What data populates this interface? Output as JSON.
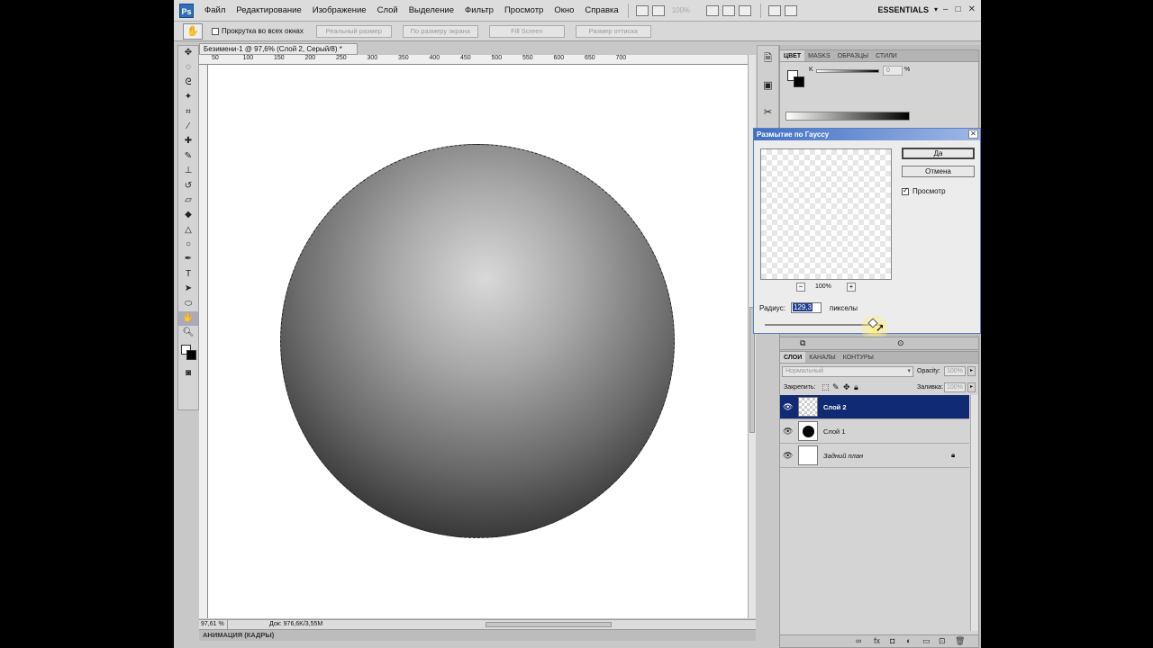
{
  "app": {
    "logo": "Ps",
    "menu": [
      "Файл",
      "Редактирование",
      "Изображение",
      "Слой",
      "Выделение",
      "Фильтр",
      "Просмотр",
      "Окно",
      "Справка"
    ],
    "zoom_display": "100%",
    "workspace": "ESSENTIALS",
    "window_buttons": [
      "–",
      "□",
      "✕"
    ]
  },
  "options_bar": {
    "scroll_all_windows": "Прокрутка во всех окнах",
    "buttons": [
      "Реальный размер",
      "По размеру экрана",
      "Fill Screen",
      "Размер оттиска"
    ]
  },
  "document": {
    "tab_title": "Безимени-1 @ 97,6% (Слой 2, Серый/8) *",
    "ruler_ticks": [
      "50",
      "100",
      "150",
      "200",
      "250",
      "300",
      "350",
      "400",
      "450",
      "500",
      "550",
      "600",
      "650",
      "700"
    ],
    "zoom": "97,61 %",
    "doc_info": "Док: 976,6K/3,55M",
    "animation_panel": "АНИМАЦИЯ (КАДРЫ)"
  },
  "color_panel": {
    "tabs": [
      "ЦВЕТ",
      "MASKS",
      "ОБРАЗЦЫ",
      "СТИЛИ"
    ],
    "k_label": "K",
    "k_value": "0",
    "k_unit": "%"
  },
  "gaussian_dialog": {
    "title": "Размытие по Гауссу",
    "ok_label": "Да",
    "cancel_label": "Отмена",
    "preview_label": "Просмотр",
    "preview_checked": true,
    "preview_zoom": "100%",
    "radius_label": "Радиус:",
    "radius_value": "129,3",
    "radius_unit": "пикселы",
    "radius_slider_fraction": 0.92
  },
  "layers_panel": {
    "tabs": [
      "СЛОИ",
      "КАНАЛЫ",
      "КОНТУРЫ"
    ],
    "blend_mode": "Нормальный",
    "opacity_label": "Opacity:",
    "opacity_value": "100%",
    "lock_label": "Закрепить:",
    "fill_label": "Заливка:",
    "fill_value": "100%",
    "layers": [
      {
        "name": "Слой 2",
        "selected": true,
        "thumb": "transparent"
      },
      {
        "name": "Слой 1",
        "selected": false,
        "thumb": "circle"
      },
      {
        "name": "Задний план",
        "selected": false,
        "thumb": "white",
        "locked": true
      }
    ]
  },
  "colors": {
    "selected_layer": "#102a73",
    "dialog_title": "#3f6fc4",
    "ps_logo": "#2f6fb8"
  }
}
